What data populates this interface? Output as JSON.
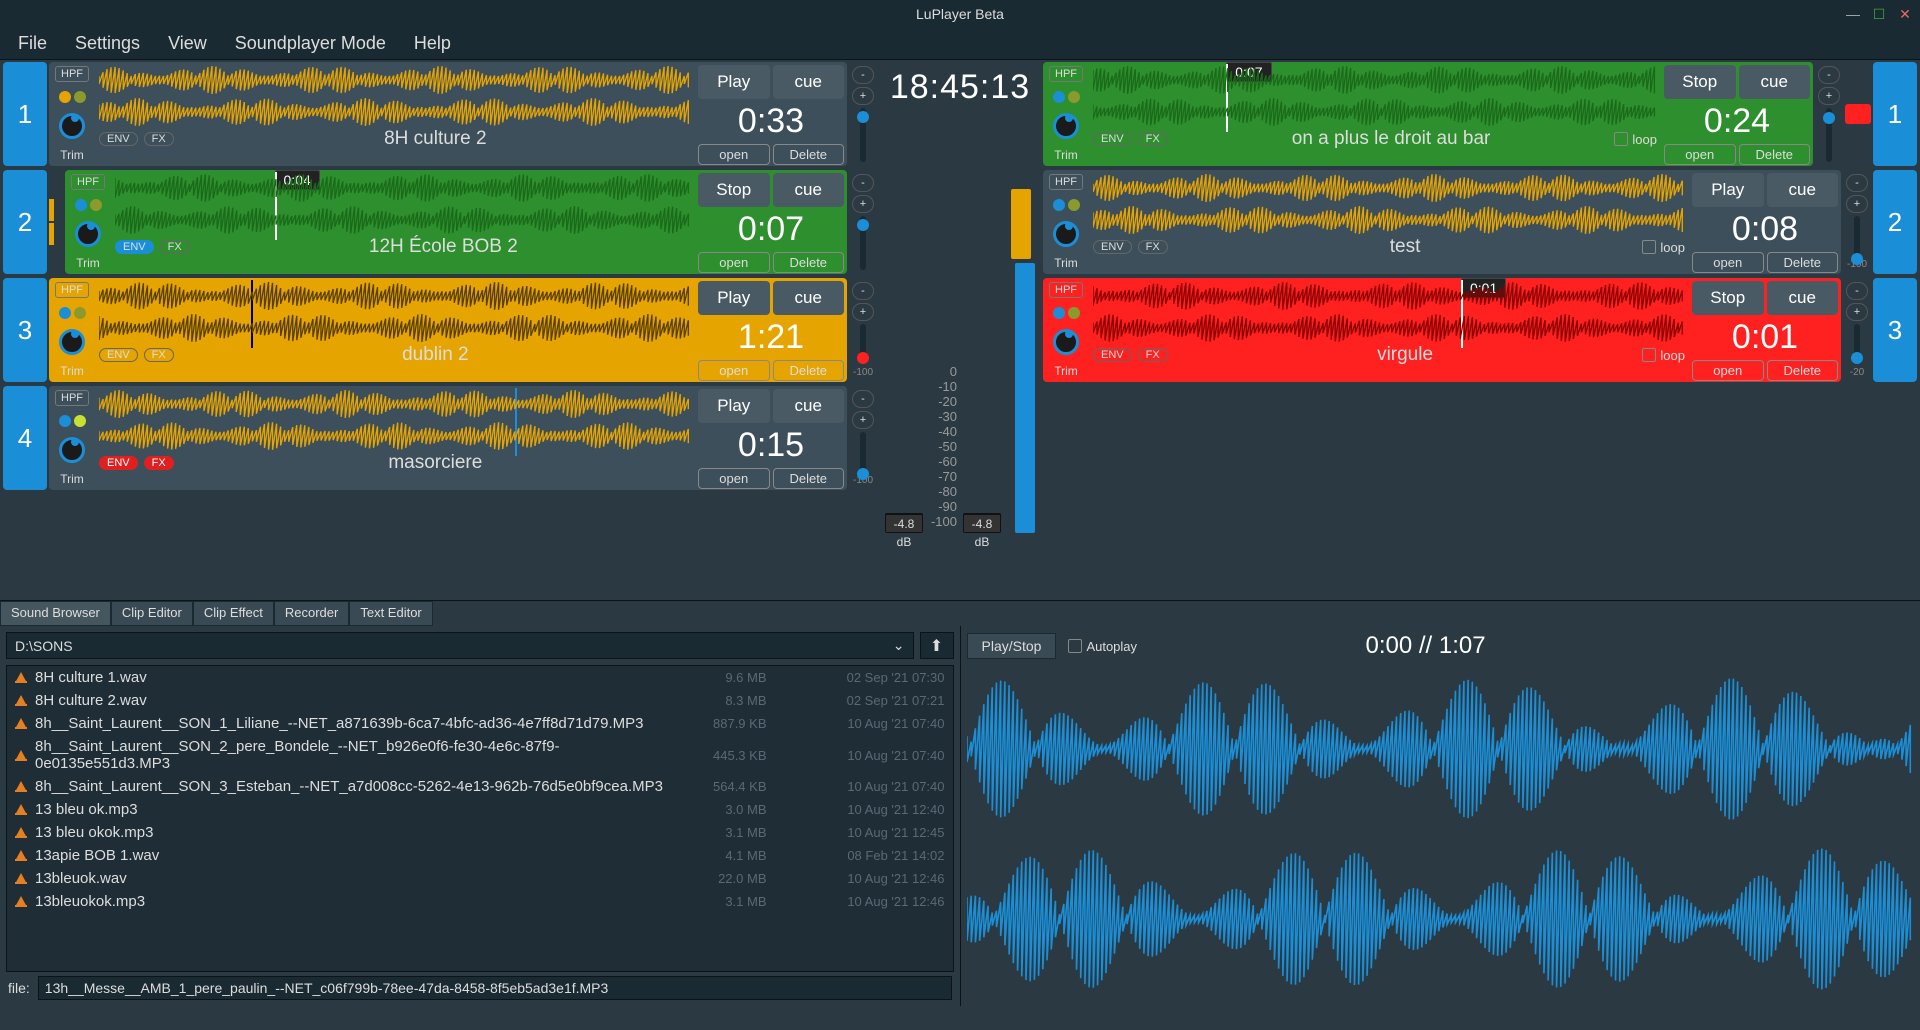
{
  "app_title": "LuPlayer Beta",
  "menu": [
    "File",
    "Settings",
    "View",
    "Soundplayer Mode",
    "Help"
  ],
  "clock": "18:45:13",
  "meter_db": "-4.8 dB",
  "scale_ticks": [
    "0",
    "-10",
    "-20",
    "-30",
    "-40",
    "-50",
    "-60",
    "-70",
    "-80",
    "-90",
    "-100"
  ],
  "deck_labels": {
    "hpf": "HPF",
    "trim": "Trim",
    "env": "ENV",
    "fx": "FX",
    "loop": "loop",
    "open": "open",
    "delete": "Delete",
    "play": "Play",
    "stop": "Stop",
    "cue": "cue"
  },
  "left_slots": [
    {
      "n": "1",
      "bg": "",
      "name": "8H culture 2",
      "time": "0:33",
      "main": "Play",
      "dots": [
        "#e6a400",
        "#8a9a2d"
      ],
      "env_style": "",
      "fx_style": "",
      "wave": "#e6a400",
      "cursor": null,
      "pos": null,
      "thumb": "blue",
      "thumb_top": "6%"
    },
    {
      "n": "2",
      "bg": "green",
      "name": "12H École BOB 2",
      "time": "0:07",
      "main": "Stop",
      "dots": [
        "#1a8fd8",
        "#8a9a2d"
      ],
      "env_style": "blue",
      "fx_style": "",
      "wave": "#1a6a1a",
      "cursor": "white",
      "cursorx": 28,
      "pos": "0:04",
      "thumb": "blue",
      "thumb_top": "6%",
      "pause": true,
      "rec": true
    },
    {
      "n": "3",
      "bg": "orange",
      "name": "dublin 2",
      "time": "1:21",
      "main": "Play",
      "dots": [
        "#1a8fd8",
        "#8a9a2d"
      ],
      "env_style": "",
      "fx_style": "",
      "wave": "#5a4000",
      "cursor": "black",
      "cursorx": 26,
      "thumb": "red",
      "thumb_top": "70%",
      "db": "-100"
    },
    {
      "n": "4",
      "bg": "",
      "name": "masorciere",
      "time": "0:15",
      "main": "Play",
      "dots": [
        "#1a8fd8",
        "#c8e030"
      ],
      "env_style": "red",
      "fx_style": "red",
      "wave": "#e6a400",
      "cursor": "blue",
      "cursorx": 70,
      "thumb": "blue",
      "thumb_top": "90%",
      "db": "-100"
    }
  ],
  "right_slots": [
    {
      "n": "1",
      "bg": "green",
      "name": "on a plus le droit au bar",
      "time": "0:24",
      "main": "Stop",
      "dots": [
        "#1a8fd8",
        "#8a9a2d"
      ],
      "wave": "#1a6a1a",
      "cursor": "white",
      "cursorx": 24,
      "pos": "0:07",
      "loop": true,
      "thumb": "blue",
      "thumb_top": "8%",
      "rec": true
    },
    {
      "n": "2",
      "bg": "",
      "name": "test",
      "time": "0:08",
      "main": "Play",
      "dots": [
        "#1a8fd8",
        "#8a9a2d"
      ],
      "wave": "#e6a400",
      "loop": true,
      "thumb": "blue",
      "thumb_top": "92%",
      "db": "-100"
    },
    {
      "n": "3",
      "bg": "red",
      "name": "virgule",
      "time": "0:01",
      "main": "Stop",
      "dots": [
        "#1a8fd8",
        "#8a9a2d"
      ],
      "wave": "#8a0000",
      "cursor": "white",
      "cursorx": 62,
      "pos": "0:01",
      "loop": true,
      "thumb": "blue",
      "thumb_top": "70%",
      "db": "-20"
    }
  ],
  "tabs": [
    "Sound Browser",
    "Clip Editor",
    "Clip Effect",
    "Recorder",
    "Text Editor"
  ],
  "active_tab": 0,
  "browser": {
    "path": "D:\\SONS",
    "files": [
      {
        "name": "8H culture 1.wav",
        "size": "9.6 MB",
        "date": "02 Sep '21 07:30"
      },
      {
        "name": "8H culture 2.wav",
        "size": "8.3 MB",
        "date": "02 Sep '21 07:21"
      },
      {
        "name": "8h__Saint_Laurent__SON_1_Liliane_--NET_a871639b-6ca7-4bfc-ad36-4e7ff8d71d79.MP3",
        "size": "887.9 KB",
        "date": "10 Aug '21 07:40"
      },
      {
        "name": "8h__Saint_Laurent__SON_2_pere_Bondele_--NET_b926e0f6-fe30-4e6c-87f9-0e0135e551d3.MP3",
        "size": "445.3 KB",
        "date": "10 Aug '21 07:40"
      },
      {
        "name": "8h__Saint_Laurent__SON_3_Esteban_--NET_a7d008cc-5262-4e13-962b-76d5e0bf9cea.MP3",
        "size": "564.4 KB",
        "date": "10 Aug '21 07:40"
      },
      {
        "name": "13 bleu ok.mp3",
        "size": "3.0 MB",
        "date": "10 Aug '21 12:40"
      },
      {
        "name": "13 bleu okok.mp3",
        "size": "3.1 MB",
        "date": "10 Aug '21 12:45"
      },
      {
        "name": "13apie BOB 1.wav",
        "size": "4.1 MB",
        "date": "08 Feb '21 14:02"
      },
      {
        "name": "13bleuok.wav",
        "size": "22.0 MB",
        "date": "10 Aug '21 12:46"
      },
      {
        "name": "13bleuokok.mp3",
        "size": "3.1 MB",
        "date": "10 Aug '21 12:46"
      }
    ],
    "file_label": "file:",
    "selected": "13h__Messe__AMB_1_pere_paulin_--NET_c06f799b-78ee-47da-8458-8f5eb5ad3e1f.MP3",
    "play_stop": "Play/Stop",
    "autoplay": "Autoplay",
    "position": "0:00 // 1:07"
  }
}
